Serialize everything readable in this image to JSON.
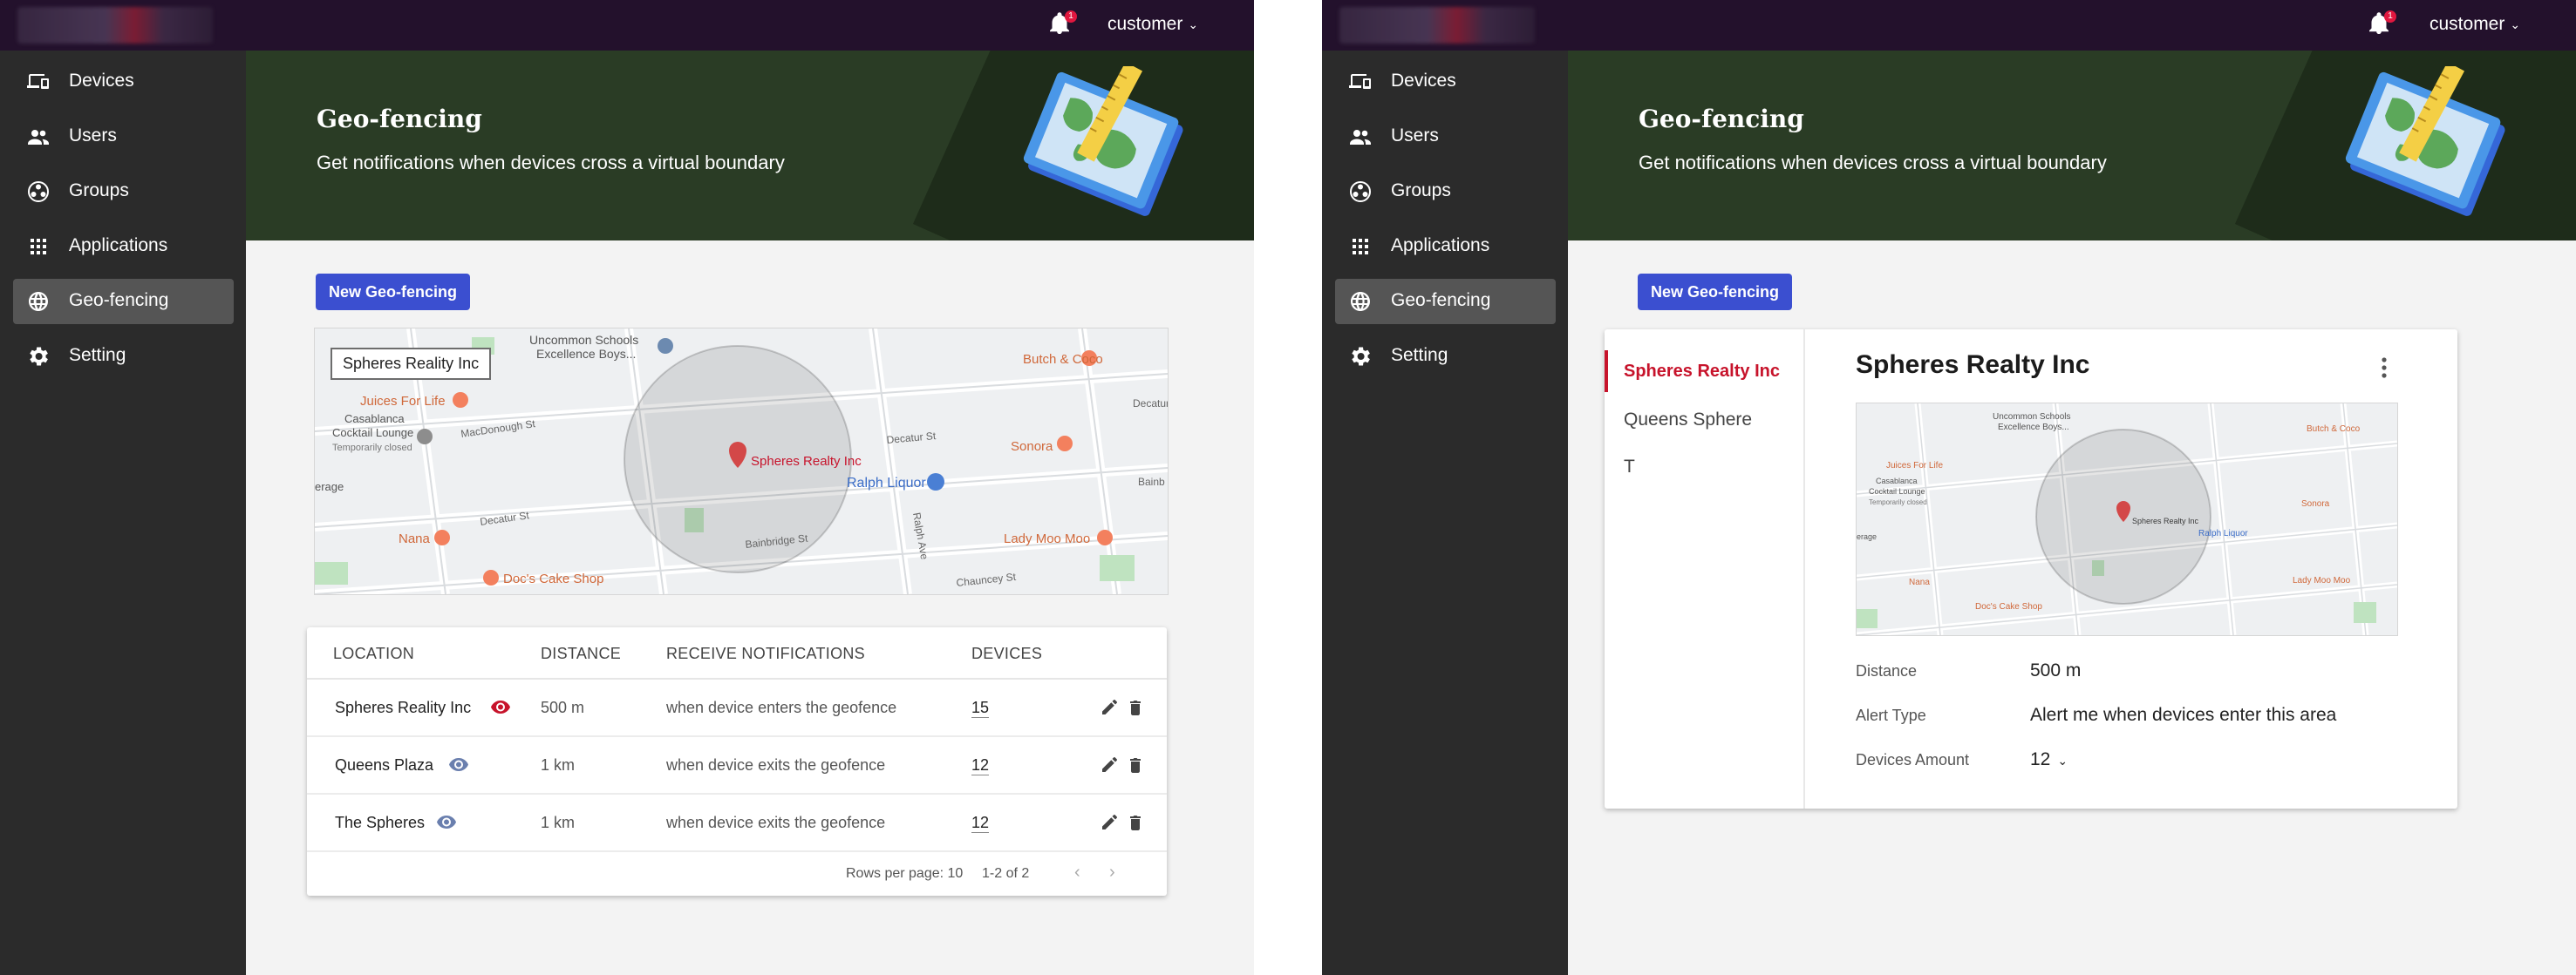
{
  "topbar": {
    "notifications": "1",
    "user": "customer"
  },
  "sidebar": {
    "items": [
      {
        "label": "Devices",
        "icon": "devices-icon"
      },
      {
        "label": "Users",
        "icon": "users-icon"
      },
      {
        "label": "Groups",
        "icon": "groups-icon"
      },
      {
        "label": "Applications",
        "icon": "apps-grid-icon"
      },
      {
        "label": "Geo-fencing",
        "icon": "globe-icon",
        "active": true
      },
      {
        "label": "Setting",
        "icon": "gear-icon"
      }
    ]
  },
  "hero": {
    "title": "Geo-fencing",
    "subtitle": "Get notifications when devices cross a virtual boundary"
  },
  "actions": {
    "new_label": "New Geo-fencing"
  },
  "map": {
    "selected_label": "Spheres Reality Inc",
    "labels": {
      "school": "Uncommon Schools",
      "school2": "Excellence Boys...",
      "butch": "Butch & Coco",
      "juices": "Juices For Life",
      "casablanca": "Casablanca",
      "cocktail": "Cocktail Lounge",
      "closed": "Temporarily closed",
      "macdonough": "MacDonough St",
      "decatur": "Decatur St",
      "decatur2": "Decatur St",
      "decatur3": "Decatur",
      "sonora": "Sonora",
      "spheres": "Spheres Realty Inc",
      "ralph": "Ralph Liquor",
      "bainb": "Bainb",
      "erage": "erage",
      "nana": "Nana",
      "ladymoo": "Lady Moo Moo",
      "bainbridge": "Bainbridge St",
      "ralphave": "Ralph Ave",
      "chauncey": "Chauncey St",
      "docs": "Doc's Cake Shop"
    }
  },
  "table": {
    "headers": [
      "LOCATION",
      "DISTANCE",
      "RECEIVE NOTIFICATIONS",
      "DEVICES"
    ],
    "rows": [
      {
        "location": "Spheres Reality Inc",
        "eye": "eye-active",
        "distance": "500 m",
        "notify": "when device enters the geofence",
        "devices": "15"
      },
      {
        "location": "Queens Plaza",
        "eye": "eye",
        "distance": "1 km",
        "notify": "when device exits the geofence",
        "devices": "12"
      },
      {
        "location": "The Spheres",
        "eye": "eye",
        "distance": "1 km",
        "notify": "when device exits the geofence",
        "devices": "12"
      }
    ],
    "footer": {
      "rows_per_page": "Rows per page: 10",
      "range": "1-2 of 2"
    }
  },
  "detail": {
    "list": [
      "Spheres Realty Inc",
      "Queens Sphere",
      "T"
    ],
    "title": "Spheres Realty Inc",
    "distance_label": "Distance",
    "distance_value": "500 m",
    "alert_label": "Alert Type",
    "alert_value": "Alert me when devices enter this area",
    "devices_label": "Devices Amount",
    "devices_value": "12"
  },
  "colors": {
    "topbar": "#23112c",
    "sidebar": "#2b2b2b",
    "hero": "#2a3c25",
    "primary": "#3b4fd0",
    "accent_red": "#c7132b"
  }
}
